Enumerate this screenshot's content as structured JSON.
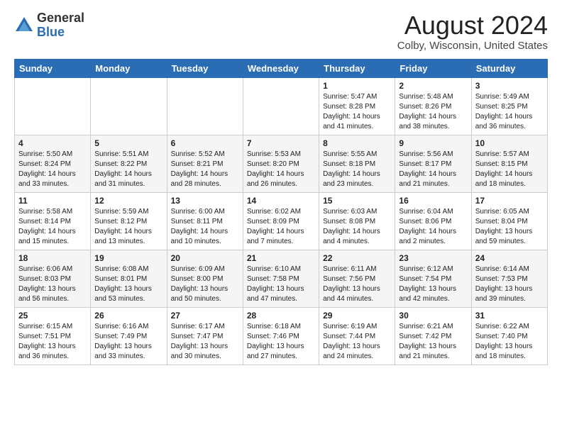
{
  "header": {
    "logo_general": "General",
    "logo_blue": "Blue",
    "month_year": "August 2024",
    "location": "Colby, Wisconsin, United States"
  },
  "weekdays": [
    "Sunday",
    "Monday",
    "Tuesday",
    "Wednesday",
    "Thursday",
    "Friday",
    "Saturday"
  ],
  "weeks": [
    [
      {
        "day": "",
        "info": ""
      },
      {
        "day": "",
        "info": ""
      },
      {
        "day": "",
        "info": ""
      },
      {
        "day": "",
        "info": ""
      },
      {
        "day": "1",
        "info": "Sunrise: 5:47 AM\nSunset: 8:28 PM\nDaylight: 14 hours\nand 41 minutes."
      },
      {
        "day": "2",
        "info": "Sunrise: 5:48 AM\nSunset: 8:26 PM\nDaylight: 14 hours\nand 38 minutes."
      },
      {
        "day": "3",
        "info": "Sunrise: 5:49 AM\nSunset: 8:25 PM\nDaylight: 14 hours\nand 36 minutes."
      }
    ],
    [
      {
        "day": "4",
        "info": "Sunrise: 5:50 AM\nSunset: 8:24 PM\nDaylight: 14 hours\nand 33 minutes."
      },
      {
        "day": "5",
        "info": "Sunrise: 5:51 AM\nSunset: 8:22 PM\nDaylight: 14 hours\nand 31 minutes."
      },
      {
        "day": "6",
        "info": "Sunrise: 5:52 AM\nSunset: 8:21 PM\nDaylight: 14 hours\nand 28 minutes."
      },
      {
        "day": "7",
        "info": "Sunrise: 5:53 AM\nSunset: 8:20 PM\nDaylight: 14 hours\nand 26 minutes."
      },
      {
        "day": "8",
        "info": "Sunrise: 5:55 AM\nSunset: 8:18 PM\nDaylight: 14 hours\nand 23 minutes."
      },
      {
        "day": "9",
        "info": "Sunrise: 5:56 AM\nSunset: 8:17 PM\nDaylight: 14 hours\nand 21 minutes."
      },
      {
        "day": "10",
        "info": "Sunrise: 5:57 AM\nSunset: 8:15 PM\nDaylight: 14 hours\nand 18 minutes."
      }
    ],
    [
      {
        "day": "11",
        "info": "Sunrise: 5:58 AM\nSunset: 8:14 PM\nDaylight: 14 hours\nand 15 minutes."
      },
      {
        "day": "12",
        "info": "Sunrise: 5:59 AM\nSunset: 8:12 PM\nDaylight: 14 hours\nand 13 minutes."
      },
      {
        "day": "13",
        "info": "Sunrise: 6:00 AM\nSunset: 8:11 PM\nDaylight: 14 hours\nand 10 minutes."
      },
      {
        "day": "14",
        "info": "Sunrise: 6:02 AM\nSunset: 8:09 PM\nDaylight: 14 hours\nand 7 minutes."
      },
      {
        "day": "15",
        "info": "Sunrise: 6:03 AM\nSunset: 8:08 PM\nDaylight: 14 hours\nand 4 minutes."
      },
      {
        "day": "16",
        "info": "Sunrise: 6:04 AM\nSunset: 8:06 PM\nDaylight: 14 hours\nand 2 minutes."
      },
      {
        "day": "17",
        "info": "Sunrise: 6:05 AM\nSunset: 8:04 PM\nDaylight: 13 hours\nand 59 minutes."
      }
    ],
    [
      {
        "day": "18",
        "info": "Sunrise: 6:06 AM\nSunset: 8:03 PM\nDaylight: 13 hours\nand 56 minutes."
      },
      {
        "day": "19",
        "info": "Sunrise: 6:08 AM\nSunset: 8:01 PM\nDaylight: 13 hours\nand 53 minutes."
      },
      {
        "day": "20",
        "info": "Sunrise: 6:09 AM\nSunset: 8:00 PM\nDaylight: 13 hours\nand 50 minutes."
      },
      {
        "day": "21",
        "info": "Sunrise: 6:10 AM\nSunset: 7:58 PM\nDaylight: 13 hours\nand 47 minutes."
      },
      {
        "day": "22",
        "info": "Sunrise: 6:11 AM\nSunset: 7:56 PM\nDaylight: 13 hours\nand 44 minutes."
      },
      {
        "day": "23",
        "info": "Sunrise: 6:12 AM\nSunset: 7:54 PM\nDaylight: 13 hours\nand 42 minutes."
      },
      {
        "day": "24",
        "info": "Sunrise: 6:14 AM\nSunset: 7:53 PM\nDaylight: 13 hours\nand 39 minutes."
      }
    ],
    [
      {
        "day": "25",
        "info": "Sunrise: 6:15 AM\nSunset: 7:51 PM\nDaylight: 13 hours\nand 36 minutes."
      },
      {
        "day": "26",
        "info": "Sunrise: 6:16 AM\nSunset: 7:49 PM\nDaylight: 13 hours\nand 33 minutes."
      },
      {
        "day": "27",
        "info": "Sunrise: 6:17 AM\nSunset: 7:47 PM\nDaylight: 13 hours\nand 30 minutes."
      },
      {
        "day": "28",
        "info": "Sunrise: 6:18 AM\nSunset: 7:46 PM\nDaylight: 13 hours\nand 27 minutes."
      },
      {
        "day": "29",
        "info": "Sunrise: 6:19 AM\nSunset: 7:44 PM\nDaylight: 13 hours\nand 24 minutes."
      },
      {
        "day": "30",
        "info": "Sunrise: 6:21 AM\nSunset: 7:42 PM\nDaylight: 13 hours\nand 21 minutes."
      },
      {
        "day": "31",
        "info": "Sunrise: 6:22 AM\nSunset: 7:40 PM\nDaylight: 13 hours\nand 18 minutes."
      }
    ]
  ]
}
